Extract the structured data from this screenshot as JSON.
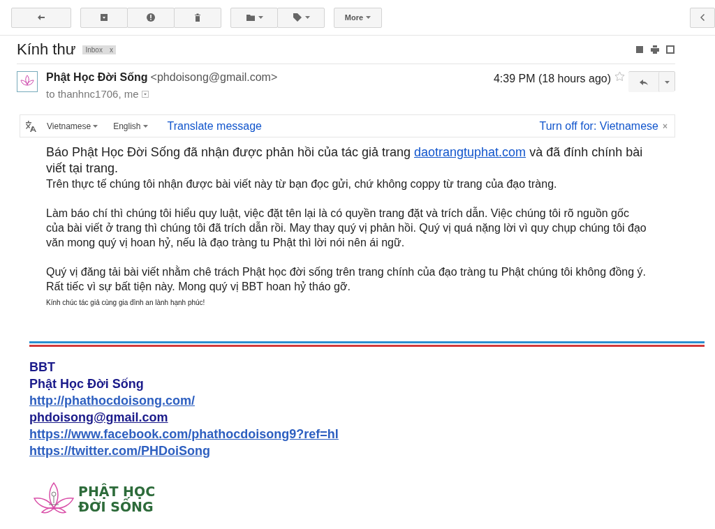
{
  "toolbar": {
    "more_label": "More"
  },
  "subject": {
    "title": "Kính thư",
    "label": "Inbox",
    "label_close": "x"
  },
  "sender": {
    "name": "Phật Học Đời Sống",
    "email": "<phdoisong@gmail.com>",
    "recipients": "to thanhnc1706, me",
    "time": "4:39 PM (18 hours ago)",
    "starred": false
  },
  "translate_bar": {
    "from": "Vietnamese",
    "to": "English",
    "action": "Translate message",
    "turn_off": "Turn off for: Vietnamese",
    "close": "×"
  },
  "body": {
    "lead": {
      "before": "Báo Phật Học Đời Sống đã nhận được phản hồi của tác giả trang ",
      "link": "daotrangtuphat.com",
      "after": " và đã đính chính bài viết tại trang."
    },
    "paragraphs": [
      "Trên thực tế chúng tôi nhận được bài viết này từ bạn đọc gửi, chứ không coppy từ trang của đạo tràng.",
      "Làm báo chí thì chúng tôi hiểu quy luật, việc đặt tên lại là có quyền trang đặt và trích dẫn. Việc chúng tôi rõ nguồn gốc của bài viết ở trang thì chúng tôi đã trích dẫn rồi. May thay quý vị phản hồi. Quý vị quá nặng lời vì quy chụp chúng tôi đạo văn mong quý vị hoan hỷ, nếu là đạo tràng tu Phật thì lời nói nên ái ngữ.",
      "Quý vị đăng tải bài viết nhằm chê trách Phật học đời sống trên trang chính của đạo tràng tu Phật chúng tôi không đồng ý. Rất tiếc vì sự bất tiện này. Mong quý vị BBT hoan hỷ tháo gỡ."
    ],
    "closing": "Kính chúc tác giả cùng gia đình an lành hạnh phúc!"
  },
  "signature": {
    "lines": [
      {
        "kind": "name",
        "text": "BBT"
      },
      {
        "kind": "name",
        "text": "Phật Học Đời Sống"
      },
      {
        "kind": "link",
        "text": "http://phathocdoisong.com/"
      },
      {
        "kind": "email",
        "text": "phdoisong@gmail.com"
      },
      {
        "kind": "link",
        "text": "https://www.facebook.com/phathocdoisong9?ref=hl"
      },
      {
        "kind": "link",
        "text": "https://twitter.com/PHDoiSong"
      }
    ],
    "logo": {
      "line_1": "PHẬT HỌC",
      "line_2": "ĐỜI SỐNG"
    }
  }
}
